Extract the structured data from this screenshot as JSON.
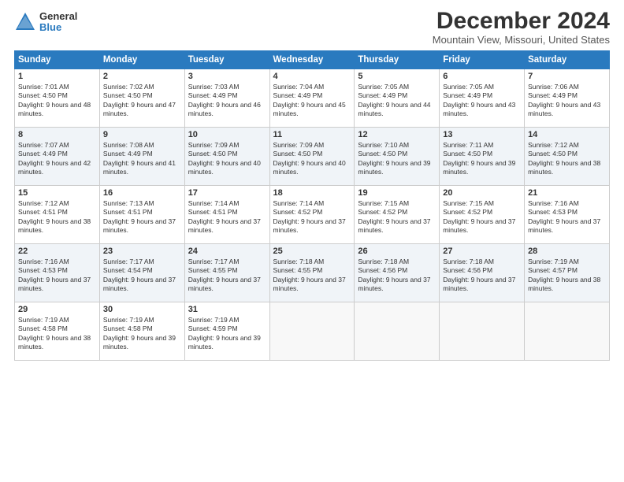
{
  "logo": {
    "general": "General",
    "blue": "Blue"
  },
  "title": "December 2024",
  "location": "Mountain View, Missouri, United States",
  "days_header": [
    "Sunday",
    "Monday",
    "Tuesday",
    "Wednesday",
    "Thursday",
    "Friday",
    "Saturday"
  ],
  "weeks": [
    [
      {
        "day": "1",
        "sunrise": "Sunrise: 7:01 AM",
        "sunset": "Sunset: 4:50 PM",
        "daylight": "Daylight: 9 hours and 48 minutes."
      },
      {
        "day": "2",
        "sunrise": "Sunrise: 7:02 AM",
        "sunset": "Sunset: 4:50 PM",
        "daylight": "Daylight: 9 hours and 47 minutes."
      },
      {
        "day": "3",
        "sunrise": "Sunrise: 7:03 AM",
        "sunset": "Sunset: 4:49 PM",
        "daylight": "Daylight: 9 hours and 46 minutes."
      },
      {
        "day": "4",
        "sunrise": "Sunrise: 7:04 AM",
        "sunset": "Sunset: 4:49 PM",
        "daylight": "Daylight: 9 hours and 45 minutes."
      },
      {
        "day": "5",
        "sunrise": "Sunrise: 7:05 AM",
        "sunset": "Sunset: 4:49 PM",
        "daylight": "Daylight: 9 hours and 44 minutes."
      },
      {
        "day": "6",
        "sunrise": "Sunrise: 7:05 AM",
        "sunset": "Sunset: 4:49 PM",
        "daylight": "Daylight: 9 hours and 43 minutes."
      },
      {
        "day": "7",
        "sunrise": "Sunrise: 7:06 AM",
        "sunset": "Sunset: 4:49 PM",
        "daylight": "Daylight: 9 hours and 43 minutes."
      }
    ],
    [
      {
        "day": "8",
        "sunrise": "Sunrise: 7:07 AM",
        "sunset": "Sunset: 4:49 PM",
        "daylight": "Daylight: 9 hours and 42 minutes."
      },
      {
        "day": "9",
        "sunrise": "Sunrise: 7:08 AM",
        "sunset": "Sunset: 4:49 PM",
        "daylight": "Daylight: 9 hours and 41 minutes."
      },
      {
        "day": "10",
        "sunrise": "Sunrise: 7:09 AM",
        "sunset": "Sunset: 4:50 PM",
        "daylight": "Daylight: 9 hours and 40 minutes."
      },
      {
        "day": "11",
        "sunrise": "Sunrise: 7:09 AM",
        "sunset": "Sunset: 4:50 PM",
        "daylight": "Daylight: 9 hours and 40 minutes."
      },
      {
        "day": "12",
        "sunrise": "Sunrise: 7:10 AM",
        "sunset": "Sunset: 4:50 PM",
        "daylight": "Daylight: 9 hours and 39 minutes."
      },
      {
        "day": "13",
        "sunrise": "Sunrise: 7:11 AM",
        "sunset": "Sunset: 4:50 PM",
        "daylight": "Daylight: 9 hours and 39 minutes."
      },
      {
        "day": "14",
        "sunrise": "Sunrise: 7:12 AM",
        "sunset": "Sunset: 4:50 PM",
        "daylight": "Daylight: 9 hours and 38 minutes."
      }
    ],
    [
      {
        "day": "15",
        "sunrise": "Sunrise: 7:12 AM",
        "sunset": "Sunset: 4:51 PM",
        "daylight": "Daylight: 9 hours and 38 minutes."
      },
      {
        "day": "16",
        "sunrise": "Sunrise: 7:13 AM",
        "sunset": "Sunset: 4:51 PM",
        "daylight": "Daylight: 9 hours and 37 minutes."
      },
      {
        "day": "17",
        "sunrise": "Sunrise: 7:14 AM",
        "sunset": "Sunset: 4:51 PM",
        "daylight": "Daylight: 9 hours and 37 minutes."
      },
      {
        "day": "18",
        "sunrise": "Sunrise: 7:14 AM",
        "sunset": "Sunset: 4:52 PM",
        "daylight": "Daylight: 9 hours and 37 minutes."
      },
      {
        "day": "19",
        "sunrise": "Sunrise: 7:15 AM",
        "sunset": "Sunset: 4:52 PM",
        "daylight": "Daylight: 9 hours and 37 minutes."
      },
      {
        "day": "20",
        "sunrise": "Sunrise: 7:15 AM",
        "sunset": "Sunset: 4:52 PM",
        "daylight": "Daylight: 9 hours and 37 minutes."
      },
      {
        "day": "21",
        "sunrise": "Sunrise: 7:16 AM",
        "sunset": "Sunset: 4:53 PM",
        "daylight": "Daylight: 9 hours and 37 minutes."
      }
    ],
    [
      {
        "day": "22",
        "sunrise": "Sunrise: 7:16 AM",
        "sunset": "Sunset: 4:53 PM",
        "daylight": "Daylight: 9 hours and 37 minutes."
      },
      {
        "day": "23",
        "sunrise": "Sunrise: 7:17 AM",
        "sunset": "Sunset: 4:54 PM",
        "daylight": "Daylight: 9 hours and 37 minutes."
      },
      {
        "day": "24",
        "sunrise": "Sunrise: 7:17 AM",
        "sunset": "Sunset: 4:55 PM",
        "daylight": "Daylight: 9 hours and 37 minutes."
      },
      {
        "day": "25",
        "sunrise": "Sunrise: 7:18 AM",
        "sunset": "Sunset: 4:55 PM",
        "daylight": "Daylight: 9 hours and 37 minutes."
      },
      {
        "day": "26",
        "sunrise": "Sunrise: 7:18 AM",
        "sunset": "Sunset: 4:56 PM",
        "daylight": "Daylight: 9 hours and 37 minutes."
      },
      {
        "day": "27",
        "sunrise": "Sunrise: 7:18 AM",
        "sunset": "Sunset: 4:56 PM",
        "daylight": "Daylight: 9 hours and 37 minutes."
      },
      {
        "day": "28",
        "sunrise": "Sunrise: 7:19 AM",
        "sunset": "Sunset: 4:57 PM",
        "daylight": "Daylight: 9 hours and 38 minutes."
      }
    ],
    [
      {
        "day": "29",
        "sunrise": "Sunrise: 7:19 AM",
        "sunset": "Sunset: 4:58 PM",
        "daylight": "Daylight: 9 hours and 38 minutes."
      },
      {
        "day": "30",
        "sunrise": "Sunrise: 7:19 AM",
        "sunset": "Sunset: 4:58 PM",
        "daylight": "Daylight: 9 hours and 39 minutes."
      },
      {
        "day": "31",
        "sunrise": "Sunrise: 7:19 AM",
        "sunset": "Sunset: 4:59 PM",
        "daylight": "Daylight: 9 hours and 39 minutes."
      },
      null,
      null,
      null,
      null
    ]
  ]
}
